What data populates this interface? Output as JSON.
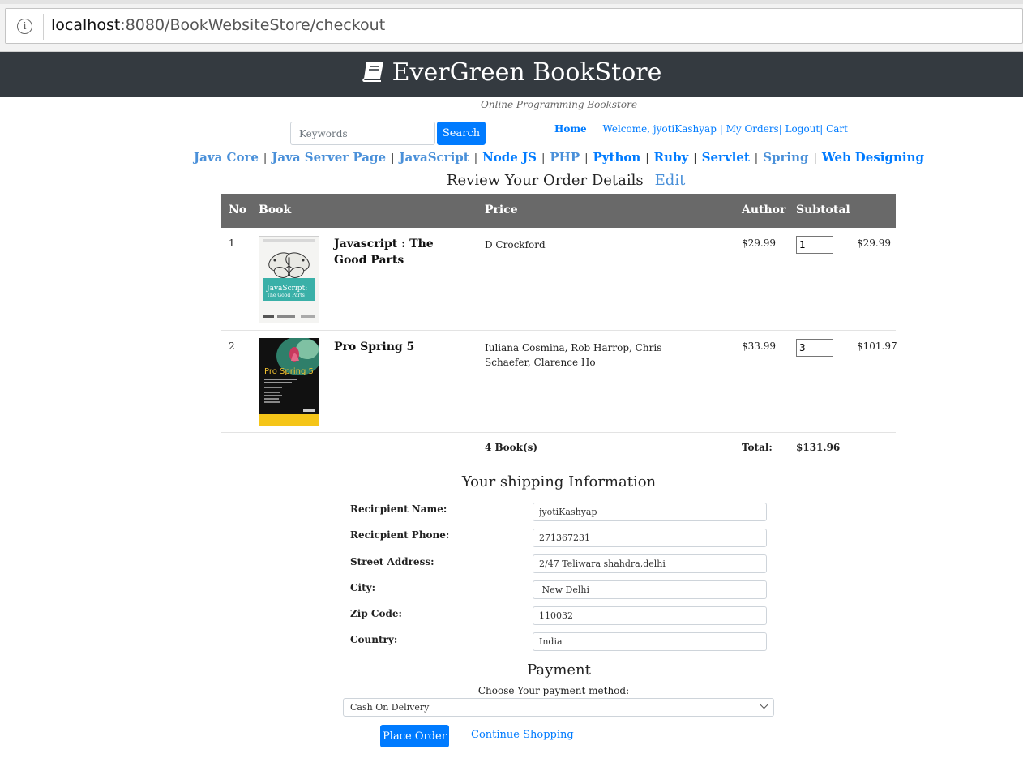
{
  "browser": {
    "url_host": "localhost",
    "url_rest": ":8080/BookWebsiteStore/checkout"
  },
  "site": {
    "title": "EverGreen BookStore",
    "tagline": "Online Programming Bookstore"
  },
  "search": {
    "placeholder": "Keywords",
    "button": "Search"
  },
  "user_nav": {
    "home": "Home",
    "welcome": "Welcome, jyotiKashyap",
    "my_orders": "My Orders",
    "logout": "Logout",
    "cart": "Cart"
  },
  "categories": [
    "Java Core",
    "Java Server Page",
    "JavaScript",
    "Node JS",
    "PHP",
    "Python",
    "Ruby",
    "Servlet",
    "Spring",
    "Web Designing"
  ],
  "review": {
    "heading": "Review Your Order Details",
    "edit": "Edit"
  },
  "table": {
    "headers": {
      "no": "No",
      "book": "Book",
      "price": "Price",
      "author": "Author",
      "subtotal": "Subtotal"
    },
    "rows": [
      {
        "no": "1",
        "title": "Javascript : The Good Parts",
        "author": "D Crockford",
        "price": "$29.99",
        "quantity": "1",
        "subtotal": "$29.99",
        "cover_title": "JavaScript:",
        "cover_subtitle": "The Good Parts"
      },
      {
        "no": "2",
        "title": "Pro Spring 5",
        "author": "Iuliana Cosmina, Rob Harrop, Chris Schaefer, Clarence Ho",
        "price": "$33.99",
        "quantity": "3",
        "subtotal": "$101.97",
        "cover_title": "Pro Spring 5"
      }
    ],
    "footer": {
      "count": "4 Book(s)",
      "total_label": "Total:",
      "total": "$131.96"
    }
  },
  "shipping": {
    "heading": "Your shipping Information",
    "fields": [
      {
        "label": "Recicpient Name:",
        "value": "jyotiKashyap"
      },
      {
        "label": "Recicpient Phone:",
        "value": "271367231"
      },
      {
        "label": "Street Address:",
        "value": "2/47 Teliwara shahdra,delhi"
      },
      {
        "label": "City:",
        "value": " New Delhi"
      },
      {
        "label": "Zip Code:",
        "value": "110032"
      },
      {
        "label": "Country:",
        "value": "India"
      }
    ]
  },
  "payment": {
    "heading": "Payment",
    "label": "Choose Your payment method:",
    "selected": "Cash On Delivery",
    "place_order": "Place Order",
    "continue": "Continue Shopping"
  },
  "colors": {
    "header_bg": "#343a40",
    "primary": "#007bff",
    "table_header": "#696969"
  }
}
